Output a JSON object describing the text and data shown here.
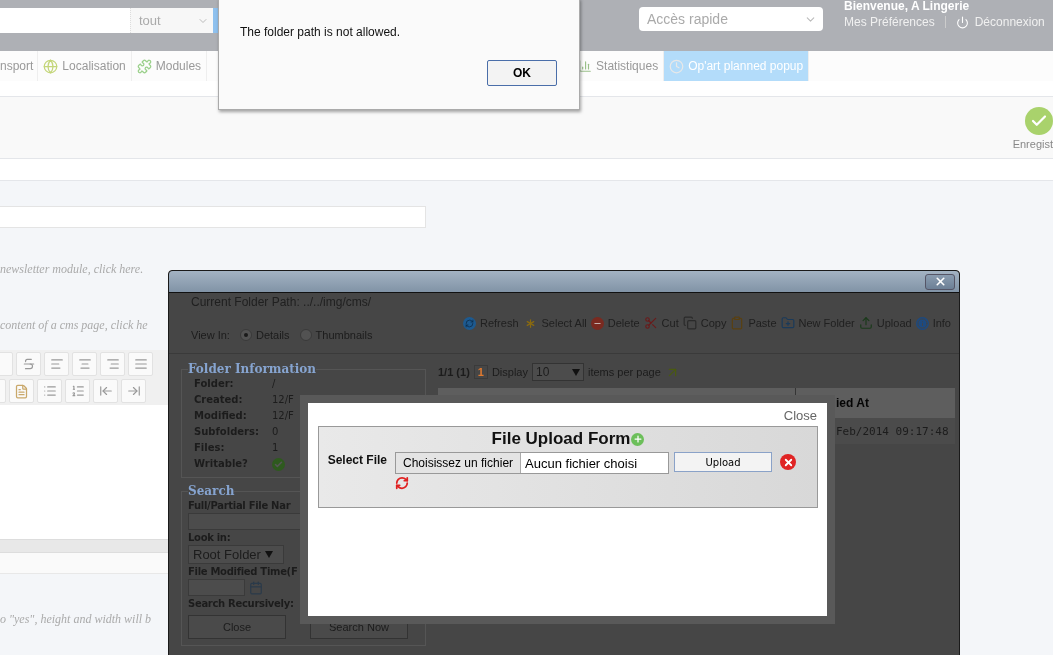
{
  "header": {
    "search_scope": "tout",
    "quick_access": {
      "placeholder": "Accès rapide"
    },
    "welcome": "Bienvenue, A Lingerie",
    "preferences": "Mes Préférences",
    "logout": "Déconnexion"
  },
  "menu": [
    {
      "label": "nsport",
      "selected": false
    },
    {
      "label": "Localisation",
      "selected": false
    },
    {
      "label": "Modules",
      "selected": false
    },
    {
      "label": "Statistiques",
      "selected": false
    },
    {
      "label": "Op'art planned popup",
      "selected": true
    }
  ],
  "toolbar": {
    "save": "Enregist"
  },
  "form": {
    "hints": [
      "newsletter module, click here.",
      "content of a cms page, click he",
      "o \"yes\", height and width will b"
    ]
  },
  "file_manager": {
    "path_label": "Current Folder Path:",
    "path": "../../img/cms/",
    "view": {
      "label": "View In:",
      "options": [
        {
          "label": "Details",
          "selected": true
        },
        {
          "label": "Thumbnails",
          "selected": false
        }
      ]
    },
    "actions": [
      "Refresh",
      "Select All",
      "Delete",
      "Cut",
      "Copy",
      "Paste",
      "New Folder",
      "Upload",
      "Info"
    ],
    "folder_info": {
      "title": "Folder Information",
      "rows": [
        {
          "label": "Folder:",
          "value": "/"
        },
        {
          "label": "Created:",
          "value": "12/F"
        },
        {
          "label": "Modified:",
          "value": "12/F"
        },
        {
          "label": "Subfolders:",
          "value": "0"
        },
        {
          "label": "Files:",
          "value": "1"
        },
        {
          "label": "Writable?",
          "writable": true
        }
      ]
    },
    "search": {
      "title": "Search",
      "name_label": "Full/Partial File Nar",
      "look_in_label": "Look in:",
      "look_in": "Root Folder",
      "time_label": "File Modified Time(F",
      "recursive_label": "Search Recursively:",
      "buttons": [
        "Close",
        "Search Now"
      ]
    },
    "list": {
      "summary": "1/1 (1)",
      "page": "1",
      "display_label": "Display",
      "per_page": "10",
      "per_page_label": "items per page",
      "column": "ied At",
      "cell": "Feb/2014 09:17:48"
    }
  },
  "upload_dialog": {
    "close": "Close",
    "title": "File Upload Form",
    "select_label": "Select File",
    "file_button": "Choisissez un fichier",
    "file_status": "Aucun fichier choisi",
    "upload": "Upload"
  },
  "alert": {
    "message": "The folder path is not allowed.",
    "ok": "OK"
  }
}
